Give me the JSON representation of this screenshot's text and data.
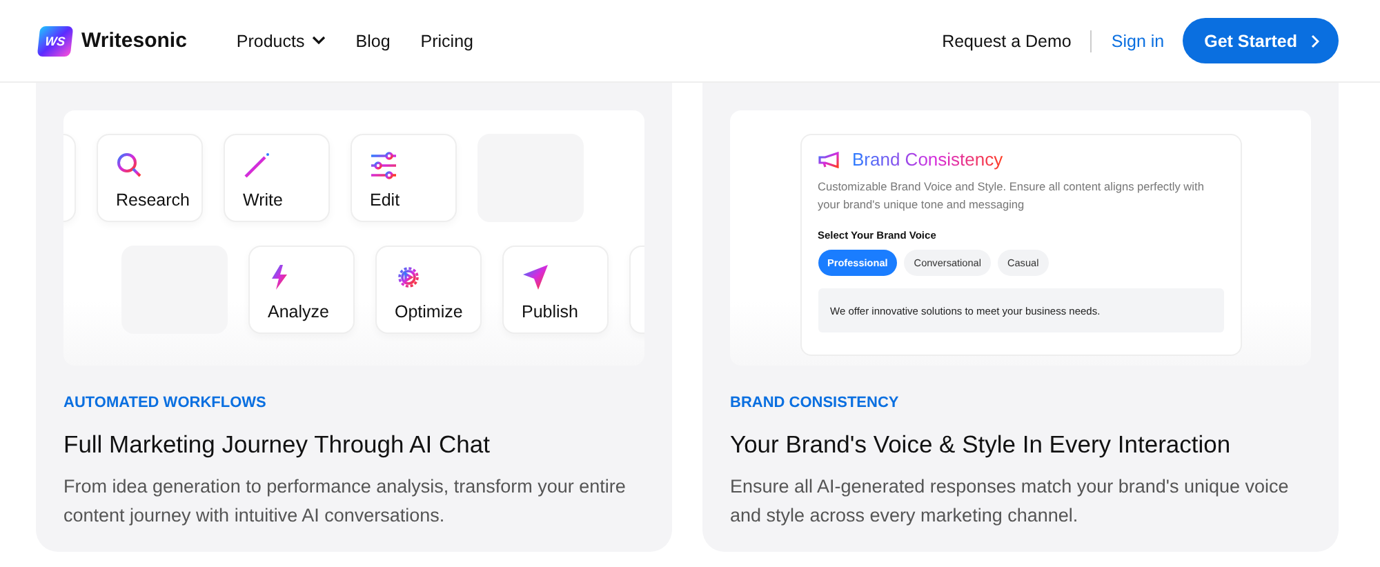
{
  "header": {
    "logo_mark": "WS",
    "brand": "Writesonic",
    "nav": [
      {
        "label": "Products",
        "dropdown": true
      },
      {
        "label": "Blog",
        "dropdown": false
      },
      {
        "label": "Pricing",
        "dropdown": false
      }
    ],
    "request_demo": "Request a Demo",
    "sign_in": "Sign in",
    "cta": "Get Started"
  },
  "cards": [
    {
      "kind": "workflow",
      "rows": [
        [
          {
            "kind": "ghost"
          },
          {
            "kind": "tool",
            "label": "Research"
          },
          {
            "kind": "tool",
            "label": "Write"
          },
          {
            "kind": "tool",
            "label": "Edit"
          },
          {
            "kind": "empty"
          }
        ],
        [
          {
            "kind": "empty"
          },
          {
            "kind": "tool",
            "label": "Analyze"
          },
          {
            "kind": "tool",
            "label": "Optimize"
          },
          {
            "kind": "tool",
            "label": "Publish"
          },
          {
            "kind": "ghost"
          }
        ]
      ],
      "eyebrow": "AUTOMATED WORKFLOWS",
      "title": "Full Marketing Journey Through AI Chat",
      "description": "From idea generation to performance analysis, transform your entire content journey with intuitive AI conversations."
    },
    {
      "kind": "brand",
      "panel": {
        "title": "Brand Consistency",
        "text": "Customizable Brand Voice and Style. Ensure all content aligns perfectly with your brand's unique tone and messaging",
        "label": "Select Your Brand Voice",
        "options": [
          {
            "label": "Professional",
            "selected": true
          },
          {
            "label": "Conversational",
            "selected": false
          },
          {
            "label": "Casual",
            "selected": false
          }
        ],
        "sample": "We offer innovative solutions to meet your business needs."
      },
      "eyebrow": "BRAND CONSISTENCY",
      "title": "Your Brand's Voice & Style In Every Interaction",
      "description": "Ensure all AI-generated responses match your brand's unique voice and style across every marketing channel."
    }
  ]
}
